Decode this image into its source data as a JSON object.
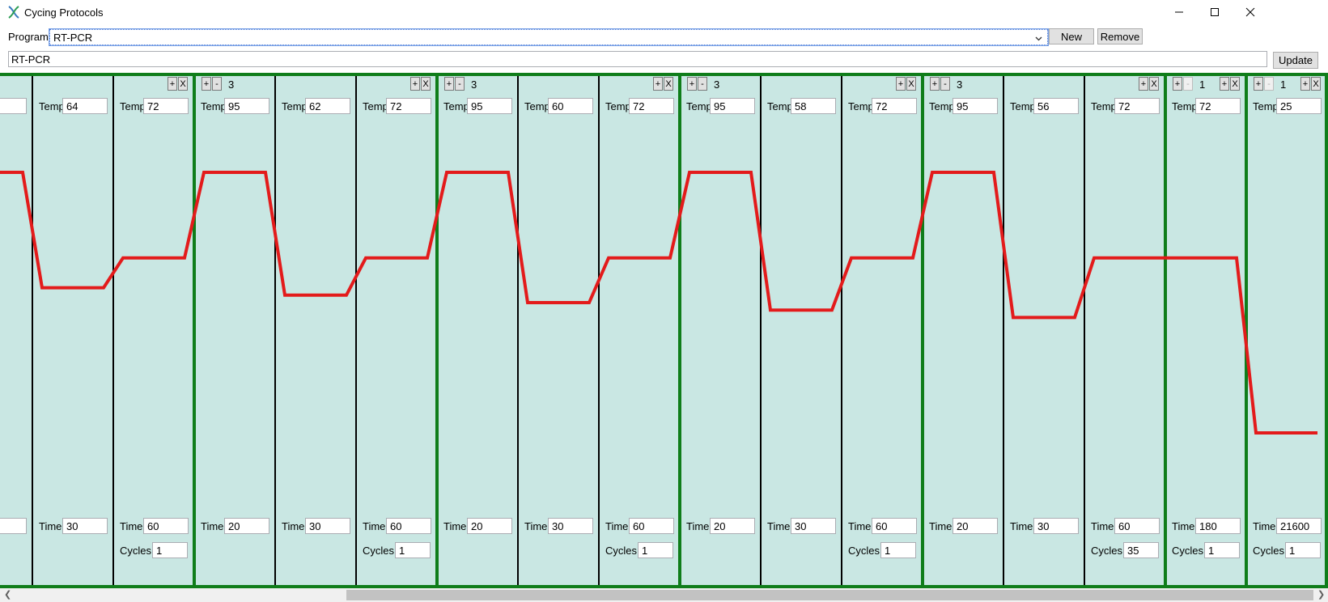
{
  "window": {
    "title": "Cycing Protocols"
  },
  "program": {
    "label": "Program",
    "selected": "RT-PCR",
    "name_value": "RT-PCR",
    "new_label": "New",
    "remove_label": "Remove",
    "update_label": "Update"
  },
  "labels": {
    "temp": "Temp",
    "time": "Time",
    "cycles": "Cycles"
  },
  "stages": [
    {
      "count": null,
      "steps": [
        {
          "temp": "",
          "time": ""
        },
        {
          "temp": "64",
          "time": "30"
        },
        {
          "temp": "72",
          "time": "60"
        }
      ],
      "cycles": "1"
    },
    {
      "count": "3",
      "steps": [
        {
          "temp": "95",
          "time": "20"
        },
        {
          "temp": "62",
          "time": "30"
        },
        {
          "temp": "72",
          "time": "60"
        }
      ],
      "cycles": "1"
    },
    {
      "count": "3",
      "steps": [
        {
          "temp": "95",
          "time": "20"
        },
        {
          "temp": "60",
          "time": "30"
        },
        {
          "temp": "72",
          "time": "60"
        }
      ],
      "cycles": "1"
    },
    {
      "count": "3",
      "steps": [
        {
          "temp": "95",
          "time": "20"
        },
        {
          "temp": "58",
          "time": "30"
        },
        {
          "temp": "72",
          "time": "60"
        }
      ],
      "cycles": "1"
    },
    {
      "count": "3",
      "steps": [
        {
          "temp": "95",
          "time": "20"
        },
        {
          "temp": "56",
          "time": "30"
        },
        {
          "temp": "72",
          "time": "60"
        }
      ],
      "cycles": "35"
    },
    {
      "count": "1",
      "steps": [
        {
          "temp": "72",
          "time": "180"
        }
      ],
      "cycles": "1"
    },
    {
      "count": "1",
      "steps": [
        {
          "temp": "25",
          "time": "21600"
        }
      ],
      "cycles": "1"
    }
  ],
  "icons": {
    "app": "dna-helix-icon",
    "minimize": "minimize-icon",
    "maximize": "maximize-icon",
    "close": "close-icon",
    "dropdown": "chevron-down-icon"
  },
  "colors": {
    "curve": "#e31b1b",
    "stage_border": "#0f7d1a",
    "panel": "#c9e7e3"
  }
}
